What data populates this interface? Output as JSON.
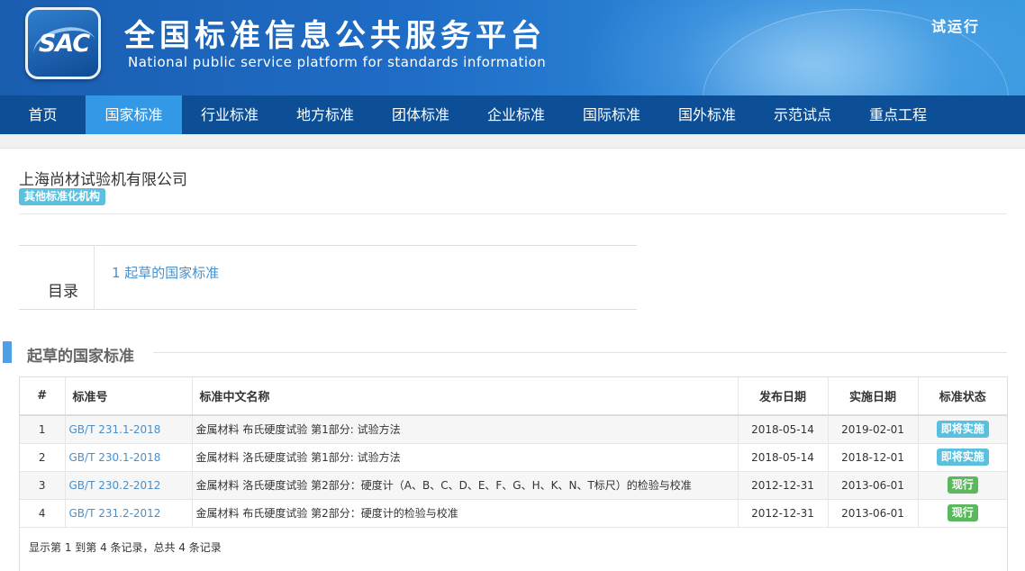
{
  "header": {
    "logo_text": "SAC",
    "title_cn": "全国标准信息公共服务平台",
    "title_en": "National public service platform  for standards information",
    "trial_label": "试运行"
  },
  "nav": {
    "items": [
      {
        "label": "首页"
      },
      {
        "label": "国家标准"
      },
      {
        "label": "行业标准"
      },
      {
        "label": "地方标准"
      },
      {
        "label": "团体标准"
      },
      {
        "label": "企业标准"
      },
      {
        "label": "国际标准"
      },
      {
        "label": "国外标准"
      },
      {
        "label": "示范试点"
      },
      {
        "label": "重点工程"
      }
    ],
    "active_index": 1
  },
  "org": {
    "name": "上海尚材试验机有限公司",
    "type_badge": "其他标准化机构"
  },
  "toc": {
    "label": "目录",
    "items": [
      {
        "label": "1  起草的国家标准"
      }
    ]
  },
  "section": {
    "title": "起草的国家标准"
  },
  "table": {
    "headers": {
      "index": "#",
      "code": "标准号",
      "name": "标准中文名称",
      "publish_date": "发布日期",
      "impl_date": "实施日期",
      "status": "标准状态"
    },
    "rows": [
      {
        "index": "1",
        "code": "GB/T 231.1-2018",
        "name": "金属材料 布氏硬度试验 第1部分: 试验方法",
        "publish_date": "2018-05-14",
        "impl_date": "2019-02-01",
        "status": "即将实施",
        "status_color": "#5bc0de"
      },
      {
        "index": "2",
        "code": "GB/T 230.1-2018",
        "name": "金属材料 洛氏硬度试验 第1部分: 试验方法",
        "publish_date": "2018-05-14",
        "impl_date": "2018-12-01",
        "status": "即将实施",
        "status_color": "#5bc0de"
      },
      {
        "index": "3",
        "code": "GB/T 230.2-2012",
        "name": "金属材料 洛氏硬度试验 第2部分：硬度计（A、B、C、D、E、F、G、H、K、N、T标尺）的检验与校准",
        "publish_date": "2012-12-31",
        "impl_date": "2013-06-01",
        "status": "现行",
        "status_color": "#5cb85c"
      },
      {
        "index": "4",
        "code": "GB/T 231.2-2012",
        "name": "金属材料 布氏硬度试验 第2部分：硬度计的检验与校准",
        "publish_date": "2012-12-31",
        "impl_date": "2013-06-01",
        "status": "现行",
        "status_color": "#5cb85c"
      }
    ],
    "summary": "显示第 1 到第 4 条记录，总共 4 条记录"
  }
}
